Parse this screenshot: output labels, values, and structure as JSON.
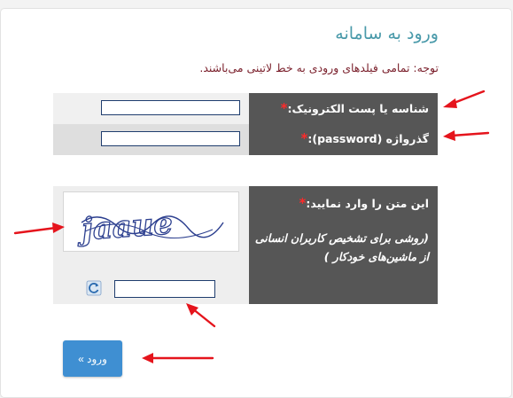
{
  "page": {
    "title": "ورود به سامانه",
    "notice": "توجه: تمامی فیلدهای ورودی به خط لاتینی می‌باشند."
  },
  "form": {
    "username_label": "شناسه یا پست الکترونیک:",
    "username_value": "",
    "password_label": "گذرواژه (password):",
    "password_value": "",
    "required_mark": "*",
    "captcha_label": "این متن را وارد نمایید:",
    "captcha_hint_line1": "(روشی برای تشخیص کاربران انسانی",
    "captcha_hint_line2": "از ماشین‌های خودکار )",
    "captcha_text": "jaaue",
    "captcha_value": "",
    "submit_label": "ورود »"
  },
  "colors": {
    "title": "#4a9aaa",
    "notice": "#7a1f2b",
    "label_bg": "#565656",
    "required": "#ff2a2a",
    "button": "#3f8fd2",
    "annotation_arrow": "#e5141c"
  },
  "icons": {
    "refresh": "refresh-icon",
    "annotation": "red-arrow"
  }
}
